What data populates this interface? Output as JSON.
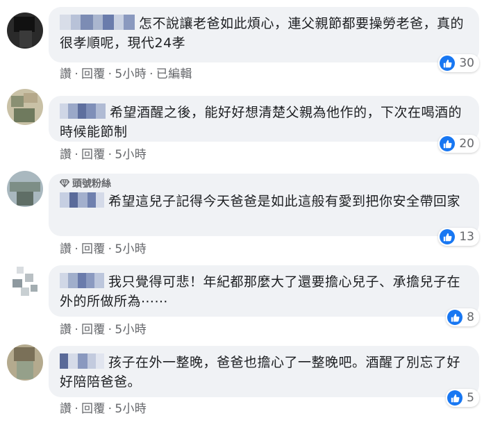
{
  "comments": [
    {
      "text": "怎不說讓老爸如此煩心，連父親節都要操勞老爸，真的很孝順呢，現代24孝",
      "reaction_count": "30",
      "actions": {
        "like": "讚",
        "reply": "回覆",
        "time": "5小時",
        "edited": "已編輯"
      },
      "badge": ""
    },
    {
      "text": "希望酒醒之後，能好好想清楚父親為他作的，下次在喝酒的時候能節制",
      "reaction_count": "20",
      "actions": {
        "like": "讚",
        "reply": "回覆",
        "time": "5小時"
      },
      "badge": ""
    },
    {
      "text": "希望這兒子記得今天爸爸是如此這般有愛到把你安全帶回家",
      "reaction_count": "13",
      "actions": {
        "like": "讚",
        "reply": "回覆",
        "time": "5小時"
      },
      "badge": "頭號粉絲"
    },
    {
      "text": "我只覺得可悲！年紀都那麼大了還要擔心兒子、承擔兒子在外的所做所為⋯⋯",
      "reaction_count": "8",
      "actions": {
        "like": "讚",
        "reply": "回覆",
        "time": "5小時"
      },
      "badge": ""
    },
    {
      "text": "孩子在外一整晚，爸爸也擔心了一整晚吧。酒醒了別忘了好好陪陪爸爸。",
      "reaction_count": "5",
      "actions": {
        "like": "讚",
        "reply": "回覆",
        "time": "5小時"
      },
      "badge": ""
    }
  ],
  "separator": "·",
  "colors": {
    "bubble": "#f0f2f5",
    "like_blue": "#1877f2",
    "meta_gray": "#65676b"
  },
  "icons": {
    "reaction": "thumbs-up-icon",
    "badge": "diamond-icon"
  }
}
